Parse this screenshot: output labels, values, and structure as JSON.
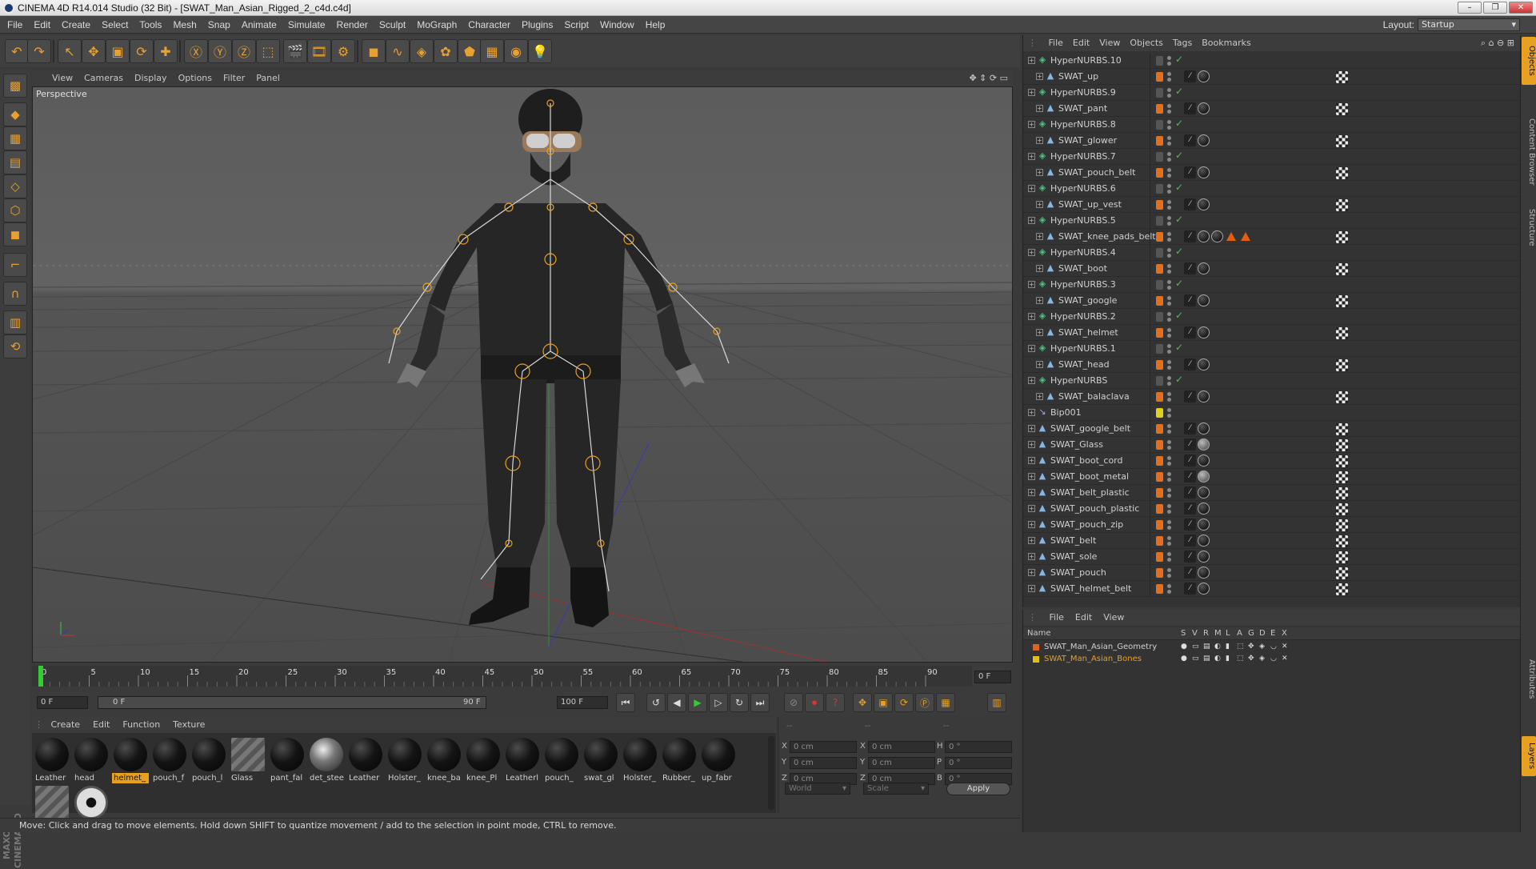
{
  "window": {
    "title": "CINEMA 4D R14.014 Studio (32 Bit) - [SWAT_Man_Asian_Rigged_2_c4d.c4d]",
    "buttons": [
      "–",
      "❐",
      "✕"
    ]
  },
  "menubar": {
    "items": [
      "File",
      "Edit",
      "Create",
      "Select",
      "Tools",
      "Mesh",
      "Snap",
      "Animate",
      "Simulate",
      "Render",
      "Sculpt",
      "MoGraph",
      "Character",
      "Plugins",
      "Script",
      "Window",
      "Help"
    ],
    "layout_label": "Layout:",
    "layout_value": "Startup"
  },
  "toolbar": {
    "buttons": [
      {
        "name": "undo-icon",
        "glyph": "↶"
      },
      {
        "name": "redo-icon",
        "glyph": "↷"
      },
      {
        "name": "live-selection-icon",
        "glyph": "↖"
      },
      {
        "name": "move-icon",
        "glyph": "✥"
      },
      {
        "name": "scale-icon",
        "glyph": "▣"
      },
      {
        "name": "rotate-icon",
        "glyph": "⟳"
      },
      {
        "name": "transform-icon",
        "glyph": "✚"
      },
      {
        "name": "x-axis-icon",
        "glyph": "Ⓧ"
      },
      {
        "name": "y-axis-icon",
        "glyph": "Ⓨ"
      },
      {
        "name": "z-axis-icon",
        "glyph": "Ⓩ"
      },
      {
        "name": "coordinate-system-icon",
        "glyph": "⬚"
      },
      {
        "name": "render-view-icon",
        "glyph": "🎬"
      },
      {
        "name": "render-picture-viewer-icon",
        "glyph": "🎞"
      },
      {
        "name": "render-settings-icon",
        "glyph": "⚙"
      },
      {
        "name": "cube-icon",
        "glyph": "◼"
      },
      {
        "name": "spline-icon",
        "glyph": "∿"
      },
      {
        "name": "nurbs-icon",
        "glyph": "◈"
      },
      {
        "name": "array-icon",
        "glyph": "✿"
      },
      {
        "name": "deformer-icon",
        "glyph": "⬟"
      },
      {
        "name": "floor-icon",
        "glyph": "▦"
      },
      {
        "name": "camera-icon",
        "glyph": "◉"
      },
      {
        "name": "light-icon",
        "glyph": "💡"
      }
    ]
  },
  "lefttools": [
    "make-editable-icon",
    "model-mode-icon",
    "texture-mode-icon",
    "workplane-icon",
    "points-mode-icon",
    "edges-mode-icon",
    "polygons-mode-icon",
    "axis-icon",
    "magnet-icon",
    "snap-icon",
    "lock-icon"
  ],
  "maxon": "MAXON CINEMA 4D",
  "viewport": {
    "menu": [
      "View",
      "Cameras",
      "Display",
      "Options",
      "Filter",
      "Panel"
    ],
    "label": "Perspective"
  },
  "timeline": {
    "ticks": [
      "0",
      "5",
      "10",
      "15",
      "20",
      "25",
      "30",
      "35",
      "40",
      "45",
      "50",
      "55",
      "60",
      "65",
      "70",
      "75",
      "80",
      "85",
      "90"
    ],
    "current_frame": "0 F"
  },
  "transport": {
    "start": "0 F",
    "range_start": "0 F",
    "range_end": "90 F",
    "end": "100 F"
  },
  "materials": {
    "menu": [
      "Create",
      "Edit",
      "Function",
      "Texture"
    ],
    "items": [
      {
        "label": "Leather",
        "style": "dark"
      },
      {
        "label": "head",
        "style": "dark"
      },
      {
        "label": "helmet_",
        "style": "dark",
        "selected": true
      },
      {
        "label": "pouch_f",
        "style": "dark"
      },
      {
        "label": "pouch_l",
        "style": "dark"
      },
      {
        "label": "Glass",
        "style": "glass"
      },
      {
        "label": "pant_fal",
        "style": "dark"
      },
      {
        "label": "det_stee",
        "style": "steel"
      },
      {
        "label": "Leather",
        "style": "dark"
      },
      {
        "label": "Holster_",
        "style": "dark"
      },
      {
        "label": "knee_ba",
        "style": "dark"
      },
      {
        "label": "knee_Pl",
        "style": "dark"
      },
      {
        "label": "Leatherl",
        "style": "dark"
      },
      {
        "label": "pouch_",
        "style": "dark"
      },
      {
        "label": "swat_gl",
        "style": "dark"
      },
      {
        "label": "Holster_",
        "style": "dark"
      },
      {
        "label": "Rubber_",
        "style": "dark"
      },
      {
        "label": "up_fabr",
        "style": "dark"
      },
      {
        "label": "",
        "style": "glass"
      },
      {
        "label": "",
        "style": "eye"
      }
    ]
  },
  "coord": {
    "header": [
      "--",
      "--",
      "--"
    ],
    "rows": [
      {
        "a": "X",
        "av": "0 cm",
        "b": "X",
        "bv": "0 cm",
        "c": "H",
        "cv": "0 °"
      },
      {
        "a": "Y",
        "av": "0 cm",
        "b": "Y",
        "bv": "0 cm",
        "c": "P",
        "cv": "0 °"
      },
      {
        "a": "Z",
        "av": "0 cm",
        "b": "Z",
        "bv": "0 cm",
        "c": "B",
        "cv": "0 °"
      }
    ],
    "mode1": "World",
    "mode2": "Scale",
    "apply": "Apply"
  },
  "status": "Move: Click and drag to move elements. Hold down SHIFT to quantize movement / add to the selection in point mode, CTRL to remove.",
  "objects": {
    "menu": [
      "File",
      "Edit",
      "View",
      "Objects",
      "Tags",
      "Bookmarks"
    ],
    "rows": [
      {
        "name": "HyperNURBS.10",
        "indent": 0,
        "kind": "nurbs",
        "dot": "#555",
        "check": true,
        "tags": []
      },
      {
        "name": "SWAT_up",
        "indent": 1,
        "kind": "mesh",
        "dot": "#e07020",
        "check": false,
        "tags": [
          "phong",
          "mat1",
          "chk"
        ]
      },
      {
        "name": "HyperNURBS.9",
        "indent": 0,
        "kind": "nurbs",
        "dot": "#555",
        "check": true,
        "tags": []
      },
      {
        "name": "SWAT_pant",
        "indent": 1,
        "kind": "mesh",
        "dot": "#e07020",
        "check": false,
        "tags": [
          "phong",
          "mat1",
          "chk"
        ]
      },
      {
        "name": "HyperNURBS.8",
        "indent": 0,
        "kind": "nurbs",
        "dot": "#555",
        "check": true,
        "tags": []
      },
      {
        "name": "SWAT_glower",
        "indent": 1,
        "kind": "mesh",
        "dot": "#e07020",
        "check": false,
        "tags": [
          "phong",
          "mat1",
          "chk"
        ]
      },
      {
        "name": "HyperNURBS.7",
        "indent": 0,
        "kind": "nurbs",
        "dot": "#555",
        "check": true,
        "tags": []
      },
      {
        "name": "SWAT_pouch_belt",
        "indent": 1,
        "kind": "mesh",
        "dot": "#e07020",
        "check": false,
        "tags": [
          "phong",
          "mat1",
          "chk"
        ]
      },
      {
        "name": "HyperNURBS.6",
        "indent": 0,
        "kind": "nurbs",
        "dot": "#555",
        "check": true,
        "tags": []
      },
      {
        "name": "SWAT_up_vest",
        "indent": 1,
        "kind": "mesh",
        "dot": "#e07020",
        "check": false,
        "tags": [
          "phong",
          "mat1",
          "chk"
        ]
      },
      {
        "name": "HyperNURBS.5",
        "indent": 0,
        "kind": "nurbs",
        "dot": "#555",
        "check": true,
        "tags": []
      },
      {
        "name": "SWAT_knee_pads_belt",
        "indent": 1,
        "kind": "mesh",
        "dot": "#e07020",
        "check": false,
        "tags": [
          "phong",
          "mat1",
          "mat1",
          "tri",
          "tri",
          "chk"
        ]
      },
      {
        "name": "HyperNURBS.4",
        "indent": 0,
        "kind": "nurbs",
        "dot": "#555",
        "check": true,
        "tags": []
      },
      {
        "name": "SWAT_boot",
        "indent": 1,
        "kind": "mesh",
        "dot": "#e07020",
        "check": false,
        "tags": [
          "phong",
          "mat1",
          "chk"
        ]
      },
      {
        "name": "HyperNURBS.3",
        "indent": 0,
        "kind": "nurbs",
        "dot": "#555",
        "check": true,
        "tags": []
      },
      {
        "name": "SWAT_google",
        "indent": 1,
        "kind": "mesh",
        "dot": "#e07020",
        "check": false,
        "tags": [
          "phong",
          "mat1",
          "chk"
        ]
      },
      {
        "name": "HyperNURBS.2",
        "indent": 0,
        "kind": "nurbs",
        "dot": "#555",
        "check": true,
        "tags": []
      },
      {
        "name": "SWAT_helmet",
        "indent": 1,
        "kind": "mesh",
        "dot": "#e07020",
        "check": false,
        "tags": [
          "phong",
          "mat1",
          "chk"
        ]
      },
      {
        "name": "HyperNURBS.1",
        "indent": 0,
        "kind": "nurbs",
        "dot": "#555",
        "check": true,
        "tags": []
      },
      {
        "name": "SWAT_head",
        "indent": 1,
        "kind": "mesh",
        "dot": "#e07020",
        "check": false,
        "tags": [
          "phong",
          "mat1",
          "chk"
        ]
      },
      {
        "name": "HyperNURBS",
        "indent": 0,
        "kind": "nurbs",
        "dot": "#555",
        "check": true,
        "tags": []
      },
      {
        "name": "SWAT_balaclava",
        "indent": 1,
        "kind": "mesh",
        "dot": "#e07020",
        "check": false,
        "tags": [
          "phong",
          "mat1",
          "chk"
        ]
      },
      {
        "name": "Bip001",
        "indent": 0,
        "kind": "bone",
        "dot": "#e0d020",
        "check": false,
        "tags": []
      },
      {
        "name": "SWAT_google_belt",
        "indent": 0,
        "kind": "mesh",
        "dot": "#e07020",
        "check": false,
        "tags": [
          "phong",
          "mat1",
          "chk"
        ]
      },
      {
        "name": "SWAT_Glass",
        "indent": 0,
        "kind": "mesh",
        "dot": "#e07020",
        "check": false,
        "tags": [
          "phong",
          "mat2",
          "chk"
        ]
      },
      {
        "name": "SWAT_boot_cord",
        "indent": 0,
        "kind": "mesh",
        "dot": "#e07020",
        "check": false,
        "tags": [
          "phong",
          "mat1",
          "chk"
        ]
      },
      {
        "name": "SWAT_boot_metal",
        "indent": 0,
        "kind": "mesh",
        "dot": "#e07020",
        "check": false,
        "tags": [
          "phong",
          "mat2",
          "chk"
        ]
      },
      {
        "name": "SWAT_belt_plastic",
        "indent": 0,
        "kind": "mesh",
        "dot": "#e07020",
        "check": false,
        "tags": [
          "phong",
          "mat1",
          "chk"
        ]
      },
      {
        "name": "SWAT_pouch_plastic",
        "indent": 0,
        "kind": "mesh",
        "dot": "#e07020",
        "check": false,
        "tags": [
          "phong",
          "mat1",
          "chk"
        ]
      },
      {
        "name": "SWAT_pouch_zip",
        "indent": 0,
        "kind": "mesh",
        "dot": "#e07020",
        "check": false,
        "tags": [
          "phong",
          "mat1",
          "chk"
        ]
      },
      {
        "name": "SWAT_belt",
        "indent": 0,
        "kind": "mesh",
        "dot": "#e07020",
        "check": false,
        "tags": [
          "phong",
          "mat1",
          "chk"
        ]
      },
      {
        "name": "SWAT_sole",
        "indent": 0,
        "kind": "mesh",
        "dot": "#e07020",
        "check": false,
        "tags": [
          "phong",
          "mat1",
          "chk"
        ]
      },
      {
        "name": "SWAT_pouch",
        "indent": 0,
        "kind": "mesh",
        "dot": "#e07020",
        "check": false,
        "tags": [
          "phong",
          "mat1",
          "chk"
        ]
      },
      {
        "name": "SWAT_helmet_belt",
        "indent": 0,
        "kind": "mesh",
        "dot": "#e07020",
        "check": false,
        "tags": [
          "phong",
          "mat1",
          "chk"
        ]
      }
    ]
  },
  "layers": {
    "menu": [
      "File",
      "Edit",
      "View"
    ],
    "header": {
      "name": "Name",
      "cols": [
        "S",
        "V",
        "R",
        "M",
        "L",
        "A",
        "G",
        "D",
        "E",
        "X"
      ]
    },
    "rows": [
      {
        "name": "SWAT_Man_Asian_Geometry",
        "color": "#e06020",
        "text": "#d0d0d0"
      },
      {
        "name": "SWAT_Man_Asian_Bones",
        "color": "#e0c020",
        "text": "#e8a020"
      }
    ]
  },
  "righttabs": [
    {
      "label": "Objects",
      "active": true
    },
    {
      "label": "Content Browser",
      "active": false
    },
    {
      "label": "Structure",
      "active": false
    },
    {
      "label": "Attributes",
      "active": false
    },
    {
      "label": "Layers",
      "active": true
    }
  ],
  "colors": {
    "accent": "#e8a020",
    "viewport_bg": "#5e5e5e",
    "panel_bg": "#333333"
  }
}
